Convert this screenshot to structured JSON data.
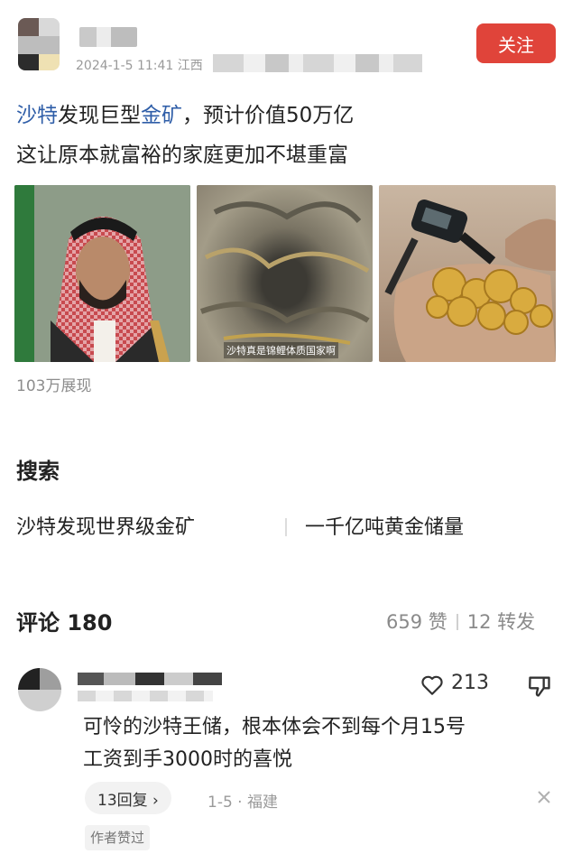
{
  "header": {
    "meta_text": "2024-1-5 11:41 江西",
    "follow_label": "关注",
    "follow_color": "#e0443a"
  },
  "post": {
    "line1_a": "沙特",
    "line1_b": "发现巨型",
    "line1_c": "金矿",
    "line1_d": "，预计价值50万亿",
    "line2": "这让原本就富裕的家庭更加不堪重富",
    "image_caption": "沙特真是锦鲤体质国家啊",
    "views": "103万展现",
    "highlight_color": "#2f5ea8"
  },
  "search": {
    "title": "搜索",
    "suggestions": [
      "沙特发现世界级金矿",
      "一千亿吨黄金储量"
    ]
  },
  "comments": {
    "label": "评论",
    "count": "180",
    "likes": "659 赞",
    "shares": "12 转发"
  },
  "comment": {
    "like_count": "213",
    "text_line1": "可怜的沙特王储，根本体会不到每个月15号",
    "text_line2": "工资到手3000时的喜悦",
    "reply_label": "13回复 ›",
    "meta": "1-5 · 福建",
    "author_tag": "作者赞过"
  },
  "icons": [
    "heart-icon",
    "thumbs-down-icon",
    "close-icon"
  ]
}
